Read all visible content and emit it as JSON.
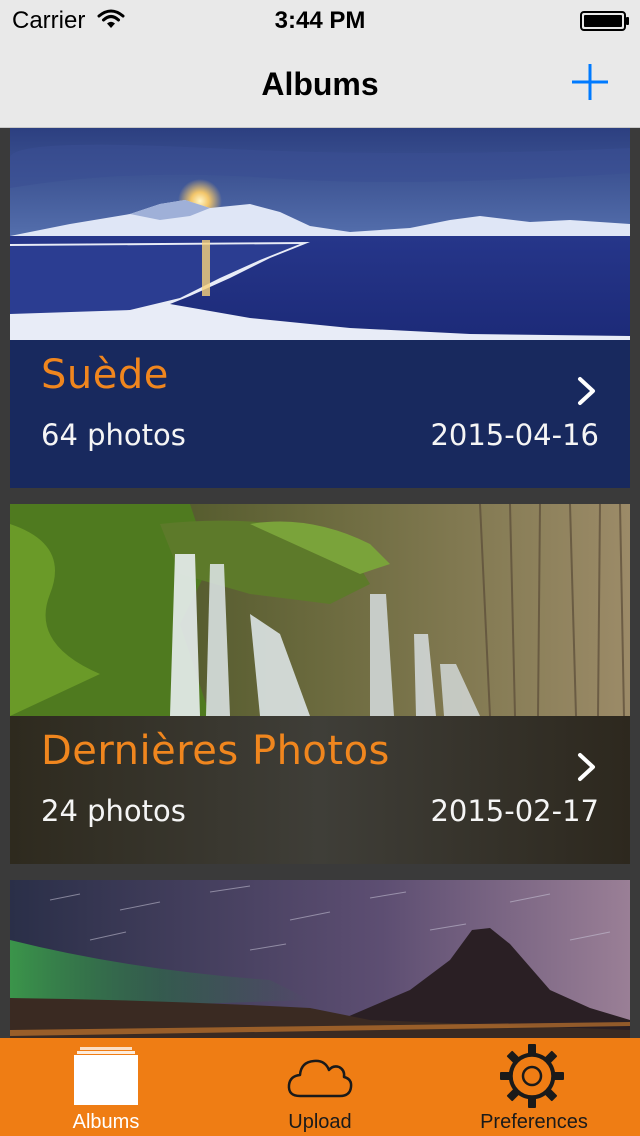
{
  "status_bar": {
    "carrier": "Carrier",
    "time": "3:44 PM",
    "wifi_icon": "wifi-icon",
    "battery_icon": "battery-full-icon"
  },
  "nav_bar": {
    "title": "Albums",
    "add_icon": "plus-icon"
  },
  "albums": [
    {
      "name": "Suède",
      "count": "64 photos",
      "date": "2015-04-16",
      "chevron": "chevron-right-icon"
    },
    {
      "name": "Dernières Photos",
      "count": "24 photos",
      "date": "2015-02-17",
      "chevron": "chevron-right-icon"
    },
    {
      "name": "",
      "count": "",
      "date": ""
    }
  ],
  "tab_bar": {
    "tabs": [
      {
        "label": "Albums",
        "icon": "albums-stack-icon",
        "active": true
      },
      {
        "label": "Upload",
        "icon": "cloud-icon",
        "active": false
      },
      {
        "label": "Preferences",
        "icon": "gear-icon",
        "active": false
      }
    ]
  },
  "colors": {
    "accent_orange": "#ef7d14",
    "album_title": "#f0861e",
    "ios_blue": "#007aff",
    "nav_background": "#e9e9e9"
  }
}
